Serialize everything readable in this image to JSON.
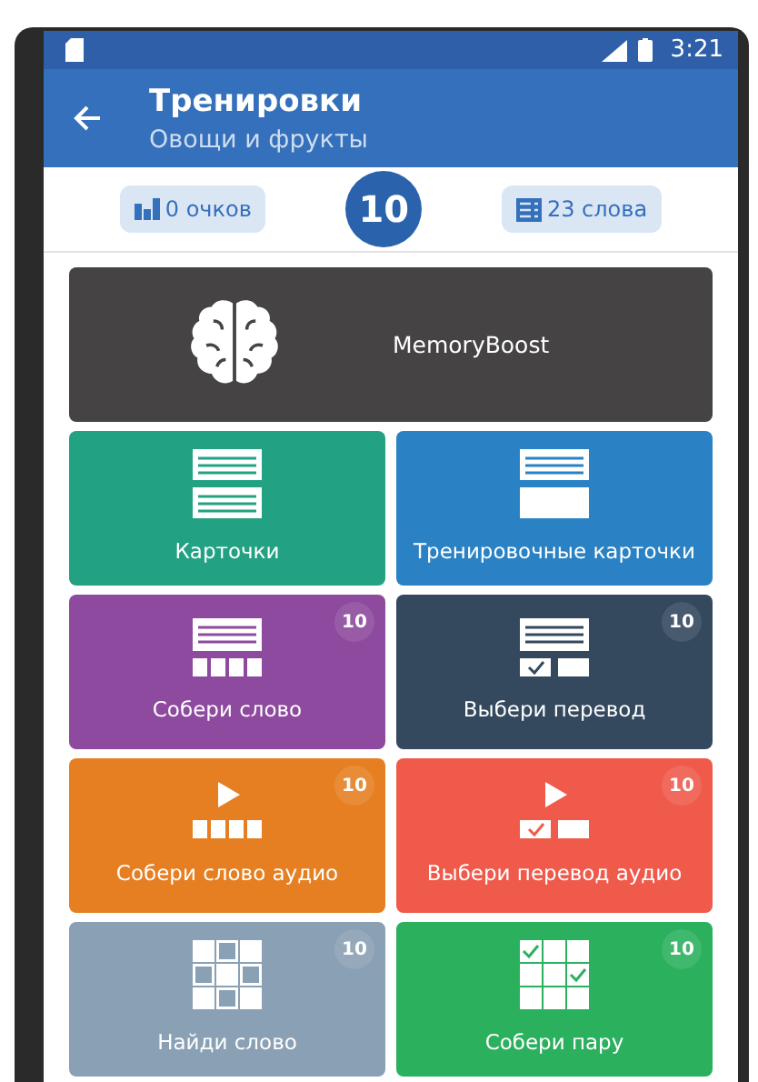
{
  "status_bar": {
    "time": "3:21"
  },
  "app_bar": {
    "title": "Тренировки",
    "subtitle": "Овощи и фрукты"
  },
  "stats": {
    "points": "0 очков",
    "level": "10",
    "words": "23 слова"
  },
  "featured": {
    "label": "MemoryBoost",
    "color": "#454343"
  },
  "trainings": [
    {
      "kind": "cards",
      "label": "Карточки",
      "color": "#22a283"
    },
    {
      "kind": "training-cards",
      "label": "Тренировочные карточки",
      "color": "#2a82c4"
    },
    {
      "kind": "assemble",
      "label": "Собери слово",
      "color": "#8d4a9e",
      "badge": "10"
    },
    {
      "kind": "choose",
      "label": "Выбери перевод",
      "color": "#34485e",
      "badge": "10"
    },
    {
      "kind": "assemble-audio",
      "label": "Собери слово аудио",
      "color": "#e67f22",
      "badge": "10"
    },
    {
      "kind": "choose-audio",
      "label": "Выбери перевод аудио",
      "color": "#ef5a4b",
      "badge": "10"
    },
    {
      "kind": "find",
      "label": "Найди слово",
      "color": "#8aa0b4",
      "badge": "10"
    },
    {
      "kind": "pairs",
      "label": "Собери пару",
      "color": "#2bb05e",
      "badge": "10"
    }
  ]
}
